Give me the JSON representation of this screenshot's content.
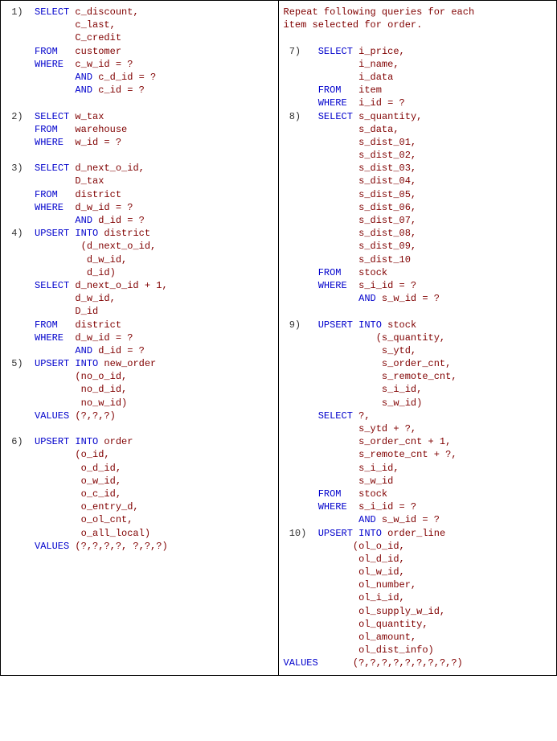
{
  "left": {
    "q1": {
      "num": " 1)  ",
      "l1a": "SELECT",
      "l1b": " c_discount,",
      "l2": "            c_last,",
      "l3": "            C_credit",
      "l4a": "     FROM",
      "l4b": "   customer",
      "l5a": "     WHERE",
      "l5b": "  c_w_id = ?",
      "l6a": "            AND",
      "l6b": " c_d_id = ?",
      "l7a": "            AND",
      "l7b": " c_id = ?"
    },
    "q2": {
      "num": " 2)  ",
      "sel": "SELECT",
      "selv": " w_tax",
      "frm": "     FROM",
      "frmv": "   warehouse",
      "whr": "     WHERE",
      "whrv": "  w_id = ?"
    },
    "q3": {
      "num": " 3)  ",
      "sel": "SELECT",
      "selv": " d_next_o_id,",
      "l2": "            D_tax",
      "frm": "     FROM",
      "frmv": "   district",
      "whr": "     WHERE",
      "whrv": "  d_w_id = ?",
      "anda": "            AND",
      "andb": " d_id = ?"
    },
    "q4": {
      "num": " 4)  ",
      "u1a": "UPSERT INTO",
      "u1b": " district",
      "l2": "             (d_next_o_id,",
      "l3": "              d_w_id,",
      "l4": "              d_id)",
      "sel": "     SELECT",
      "selv": " d_next_o_id + 1,",
      "l6": "            d_w_id,",
      "l7": "            D_id",
      "frm": "     FROM",
      "frmv": "   district",
      "whr": "     WHERE",
      "whrv": "  d_w_id = ?",
      "anda": "            AND",
      "andb": " d_id = ?"
    },
    "q5": {
      "num": " 5)  ",
      "u1a": "UPSERT INTO",
      "u1b": " new_order",
      "l2": "            (no_o_id,",
      "l3": "             no_d_id,",
      "l4": "             no_w_id)",
      "vals": "     VALUES",
      "valsv": " (?,?,?)"
    },
    "q6": {
      "num": " 6)  ",
      "u1a": "UPSERT INTO",
      "u1b": " order",
      "l2": "            (o_id,",
      "l3": "             o_d_id,",
      "l4": "             o_w_id,",
      "l5": "             o_c_id,",
      "l6": "             o_entry_d,",
      "l7": "             o_ol_cnt,",
      "l8": "             o_all_local)",
      "vals": "     VALUES",
      "valsv": " (?,?,?,?, ?,?,?)"
    }
  },
  "right": {
    "intro1": "Repeat following queries for each",
    "intro2": "item selected for order.",
    "q7": {
      "num": " 7)   ",
      "sel": "SELECT",
      "selv": " i_price,",
      "l2": "             i_name,",
      "l3": "             i_data",
      "frm": "      FROM",
      "frmv": "   item",
      "whr": "      WHERE",
      "whrv": "  i_id = ?"
    },
    "q8": {
      "num": " 8)   ",
      "sel": "SELECT",
      "selv": " s_quantity,",
      "l2": "             s_data,",
      "l3": "             s_dist_01,",
      "l4": "             s_dist_02,",
      "l5": "             s_dist_03,",
      "l6": "             s_dist_04,",
      "l7": "             s_dist_05,",
      "l8": "             s_dist_06,",
      "l9": "             s_dist_07,",
      "l10": "             s_dist_08,",
      "l11": "             s_dist_09,",
      "l12": "             s_dist_10",
      "frm": "      FROM",
      "frmv": "   stock",
      "whr": "      WHERE",
      "whrv": "  s_i_id = ?",
      "anda": "             AND",
      "andb": " s_w_id = ?"
    },
    "q9": {
      "num": " 9)   ",
      "u1a": "UPSERT INTO",
      "u1b": " stock",
      "l2": "                (s_quantity,",
      "l3": "                 s_ytd,",
      "l4": "                 s_order_cnt,",
      "l5": "                 s_remote_cnt,",
      "l6": "                 s_i_id,",
      "l7": "                 s_w_id)",
      "sel": "      SELECT",
      "selv": " ?,",
      "s2": "             s_ytd + ?,",
      "s3": "             s_order_cnt + 1,",
      "s4": "             s_remote_cnt + ?,",
      "s5": "             s_i_id,",
      "s6": "             s_w_id",
      "frm": "      FROM",
      "frmv": "   stock",
      "whr": "      WHERE",
      "whrv": "  s_i_id = ?",
      "anda": "             AND",
      "andb": " s_w_id = ?"
    },
    "q10": {
      "num": " 10)  ",
      "u1a": "UPSERT INTO",
      "u1b": " order_line",
      "l2": "            (ol_o_id,",
      "l3": "             ol_d_id,",
      "l4": "             ol_w_id,",
      "l5": "             ol_number,",
      "l6": "             ol_i_id,",
      "l7": "             ol_supply_w_id,",
      "l8": "             ol_quantity,",
      "l9": "             ol_amount,",
      "l10": "             ol_dist_info)",
      "vals": "VALUES",
      "valsv": "      (?,?,?,?,?,?,?,?,?)"
    }
  }
}
